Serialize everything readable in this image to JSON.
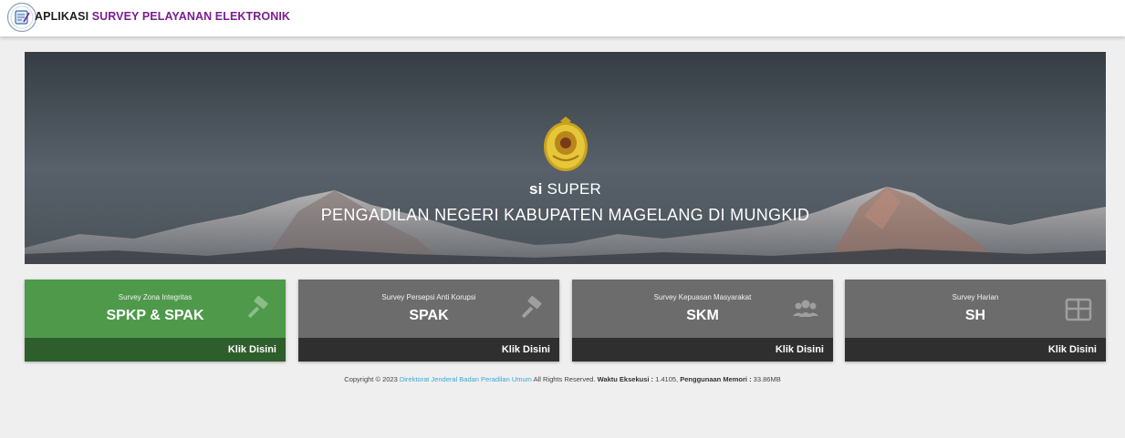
{
  "header": {
    "brand_prefix": "APLIKASI",
    "brand_suffix": " SURVEY PELAYANAN ELEKTRONIK"
  },
  "hero": {
    "app_prefix": "si",
    "app_suffix": " SUPER",
    "org": "PENGADILAN NEGERI KABUPATEN MAGELANG DI MUNGKID"
  },
  "cards": [
    {
      "subtitle": "Survey Zona Integritas",
      "title": "SPKP & SPAK",
      "link": "Klik Disini",
      "icon": "gavel-icon",
      "color": "#4e9a4a"
    },
    {
      "subtitle": "Survey Persepsi Anti Korupsi",
      "title": "SPAK",
      "link": "Klik Disini",
      "icon": "gavel-icon",
      "color": "#6c6c6c"
    },
    {
      "subtitle": "Survey Kepuasan Masyarakat",
      "title": "SKM",
      "link": "Klik Disini",
      "icon": "users-icon",
      "color": "#6c6c6c"
    },
    {
      "subtitle": "Survey Harian",
      "title": "SH",
      "link": "Klik Disini",
      "icon": "table-icon",
      "color": "#6c6c6c"
    }
  ],
  "footer": {
    "copyright": "Copyright © 2023 ",
    "org_link": "Direktorat Jenderal Badan Peradilan Umum",
    "rights": " All Rights Reserved. ",
    "exec_label": "Waktu Eksekusi :",
    "exec_value": " 1.4105, ",
    "mem_label": "Penggunaan Memori :",
    "mem_value": " 33.86MB"
  }
}
